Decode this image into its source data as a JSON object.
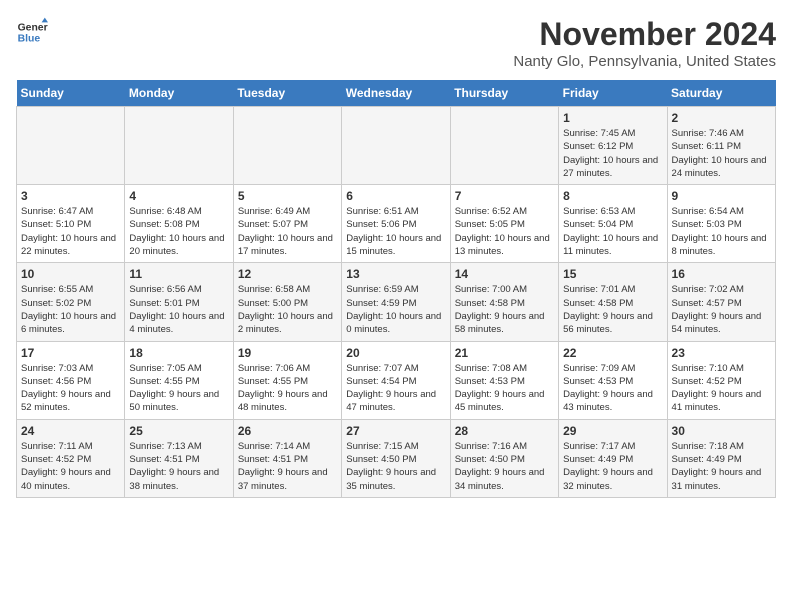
{
  "header": {
    "logo_line1": "General",
    "logo_line2": "Blue",
    "month": "November 2024",
    "location": "Nanty Glo, Pennsylvania, United States"
  },
  "weekdays": [
    "Sunday",
    "Monday",
    "Tuesday",
    "Wednesday",
    "Thursday",
    "Friday",
    "Saturday"
  ],
  "weeks": [
    [
      {
        "day": "",
        "info": ""
      },
      {
        "day": "",
        "info": ""
      },
      {
        "day": "",
        "info": ""
      },
      {
        "day": "",
        "info": ""
      },
      {
        "day": "",
        "info": ""
      },
      {
        "day": "1",
        "info": "Sunrise: 7:45 AM\nSunset: 6:12 PM\nDaylight: 10 hours and 27 minutes."
      },
      {
        "day": "2",
        "info": "Sunrise: 7:46 AM\nSunset: 6:11 PM\nDaylight: 10 hours and 24 minutes."
      }
    ],
    [
      {
        "day": "3",
        "info": "Sunrise: 6:47 AM\nSunset: 5:10 PM\nDaylight: 10 hours and 22 minutes."
      },
      {
        "day": "4",
        "info": "Sunrise: 6:48 AM\nSunset: 5:08 PM\nDaylight: 10 hours and 20 minutes."
      },
      {
        "day": "5",
        "info": "Sunrise: 6:49 AM\nSunset: 5:07 PM\nDaylight: 10 hours and 17 minutes."
      },
      {
        "day": "6",
        "info": "Sunrise: 6:51 AM\nSunset: 5:06 PM\nDaylight: 10 hours and 15 minutes."
      },
      {
        "day": "7",
        "info": "Sunrise: 6:52 AM\nSunset: 5:05 PM\nDaylight: 10 hours and 13 minutes."
      },
      {
        "day": "8",
        "info": "Sunrise: 6:53 AM\nSunset: 5:04 PM\nDaylight: 10 hours and 11 minutes."
      },
      {
        "day": "9",
        "info": "Sunrise: 6:54 AM\nSunset: 5:03 PM\nDaylight: 10 hours and 8 minutes."
      }
    ],
    [
      {
        "day": "10",
        "info": "Sunrise: 6:55 AM\nSunset: 5:02 PM\nDaylight: 10 hours and 6 minutes."
      },
      {
        "day": "11",
        "info": "Sunrise: 6:56 AM\nSunset: 5:01 PM\nDaylight: 10 hours and 4 minutes."
      },
      {
        "day": "12",
        "info": "Sunrise: 6:58 AM\nSunset: 5:00 PM\nDaylight: 10 hours and 2 minutes."
      },
      {
        "day": "13",
        "info": "Sunrise: 6:59 AM\nSunset: 4:59 PM\nDaylight: 10 hours and 0 minutes."
      },
      {
        "day": "14",
        "info": "Sunrise: 7:00 AM\nSunset: 4:58 PM\nDaylight: 9 hours and 58 minutes."
      },
      {
        "day": "15",
        "info": "Sunrise: 7:01 AM\nSunset: 4:58 PM\nDaylight: 9 hours and 56 minutes."
      },
      {
        "day": "16",
        "info": "Sunrise: 7:02 AM\nSunset: 4:57 PM\nDaylight: 9 hours and 54 minutes."
      }
    ],
    [
      {
        "day": "17",
        "info": "Sunrise: 7:03 AM\nSunset: 4:56 PM\nDaylight: 9 hours and 52 minutes."
      },
      {
        "day": "18",
        "info": "Sunrise: 7:05 AM\nSunset: 4:55 PM\nDaylight: 9 hours and 50 minutes."
      },
      {
        "day": "19",
        "info": "Sunrise: 7:06 AM\nSunset: 4:55 PM\nDaylight: 9 hours and 48 minutes."
      },
      {
        "day": "20",
        "info": "Sunrise: 7:07 AM\nSunset: 4:54 PM\nDaylight: 9 hours and 47 minutes."
      },
      {
        "day": "21",
        "info": "Sunrise: 7:08 AM\nSunset: 4:53 PM\nDaylight: 9 hours and 45 minutes."
      },
      {
        "day": "22",
        "info": "Sunrise: 7:09 AM\nSunset: 4:53 PM\nDaylight: 9 hours and 43 minutes."
      },
      {
        "day": "23",
        "info": "Sunrise: 7:10 AM\nSunset: 4:52 PM\nDaylight: 9 hours and 41 minutes."
      }
    ],
    [
      {
        "day": "24",
        "info": "Sunrise: 7:11 AM\nSunset: 4:52 PM\nDaylight: 9 hours and 40 minutes."
      },
      {
        "day": "25",
        "info": "Sunrise: 7:13 AM\nSunset: 4:51 PM\nDaylight: 9 hours and 38 minutes."
      },
      {
        "day": "26",
        "info": "Sunrise: 7:14 AM\nSunset: 4:51 PM\nDaylight: 9 hours and 37 minutes."
      },
      {
        "day": "27",
        "info": "Sunrise: 7:15 AM\nSunset: 4:50 PM\nDaylight: 9 hours and 35 minutes."
      },
      {
        "day": "28",
        "info": "Sunrise: 7:16 AM\nSunset: 4:50 PM\nDaylight: 9 hours and 34 minutes."
      },
      {
        "day": "29",
        "info": "Sunrise: 7:17 AM\nSunset: 4:49 PM\nDaylight: 9 hours and 32 minutes."
      },
      {
        "day": "30",
        "info": "Sunrise: 7:18 AM\nSunset: 4:49 PM\nDaylight: 9 hours and 31 minutes."
      }
    ]
  ]
}
